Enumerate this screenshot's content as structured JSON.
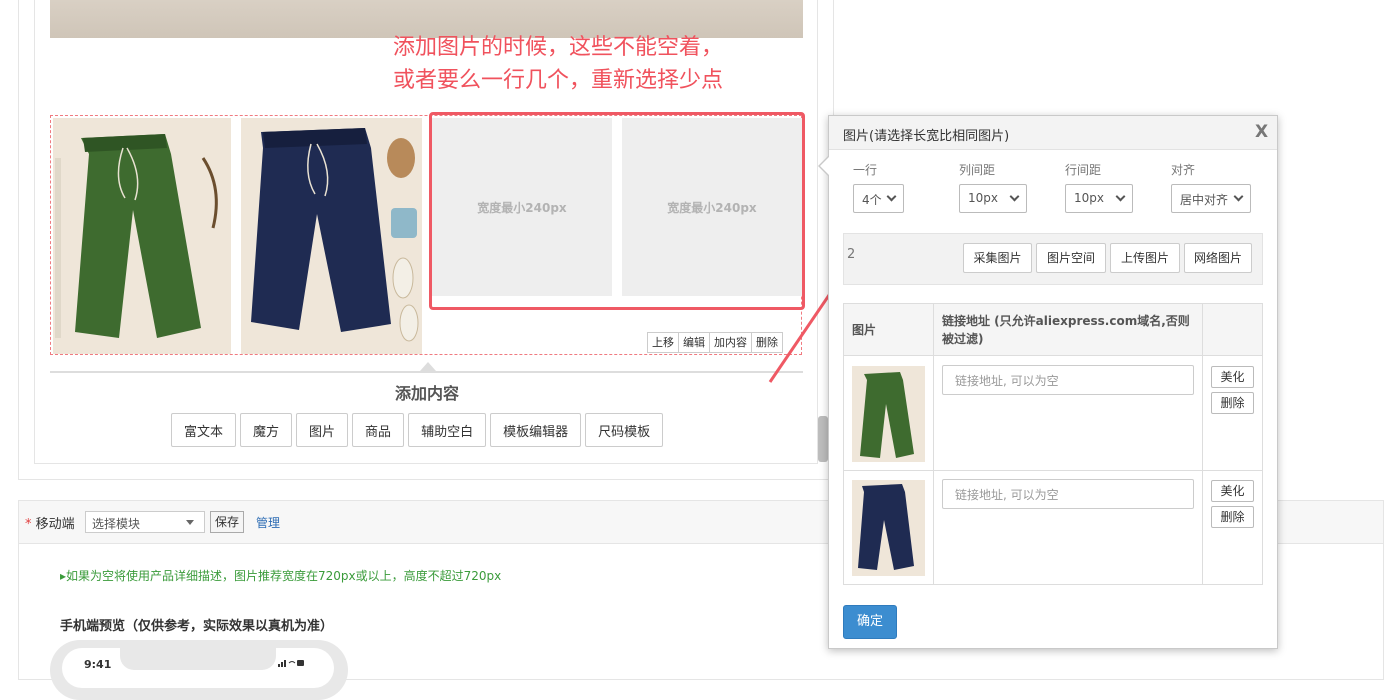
{
  "annotation": {
    "line1": "添加图片的时候，这些不能空着，",
    "line2": "或者要么一行几个，重新选择少点"
  },
  "cube": {
    "placeholder_text": "宽度最小240px",
    "mini_actions": [
      "上移",
      "编辑",
      "加内容",
      "删除"
    ]
  },
  "add_content": {
    "title": "添加内容",
    "buttons": [
      "富文本",
      "魔方",
      "图片",
      "商品",
      "辅助空白",
      "模板编辑器",
      "尺码模板"
    ]
  },
  "mobile": {
    "required_mark": "*",
    "label": "移动端",
    "module_select_value": "选择模块",
    "save_label": "保存",
    "manage_label": "管理",
    "tip": "如果为空将使用产品详细描述，图片推荐宽度在720px或以上，高度不超过720px",
    "preview_title": "手机端预览（仅供参考，实际效果以真机为准）",
    "phone_time": "9:41"
  },
  "dialog": {
    "title": "图片(请选择长宽比相同图片)",
    "close": "X",
    "options": {
      "per_row_label": "一行",
      "per_row_value": "4个",
      "col_gap_label": "列间距",
      "col_gap_value": "10px",
      "row_gap_label": "行间距",
      "row_gap_value": "10px",
      "align_label": "对齐",
      "align_value": "居中对齐"
    },
    "toolbar_count": "2",
    "toolbar_buttons": [
      "采集图片",
      "图片空间",
      "上传图片",
      "网络图片"
    ],
    "table": {
      "col_image": "图片",
      "col_link": "链接地址 (只允许aliexpress.com域名,否则被过滤)",
      "rows": [
        {
          "link_placeholder": "链接地址, 可以为空",
          "beautify": "美化",
          "delete": "删除"
        },
        {
          "link_placeholder": "链接地址, 可以为空",
          "beautify": "美化",
          "delete": "删除"
        }
      ]
    },
    "confirm": "确定"
  }
}
